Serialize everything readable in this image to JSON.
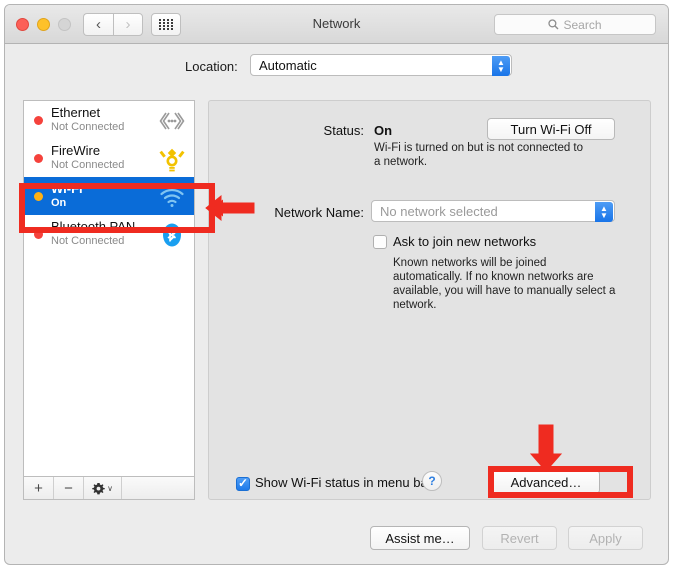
{
  "window": {
    "title": "Network",
    "traffic_lights": [
      "close",
      "minimize",
      "zoom"
    ],
    "back_glyph": "‹",
    "forward_glyph": "›",
    "grid_icon": "grid-view-icon"
  },
  "search": {
    "placeholder": "Search",
    "icon": "search-icon"
  },
  "location": {
    "label": "Location:",
    "value": "Automatic",
    "options": [
      "Automatic"
    ]
  },
  "sidebar": {
    "services": [
      {
        "name": "Ethernet",
        "status": "Not Connected",
        "dot": "red",
        "icon": "ethernet-icon",
        "selected": false
      },
      {
        "name": "FireWire",
        "status": "Not Connected",
        "dot": "red",
        "icon": "firewire-icon",
        "selected": false
      },
      {
        "name": "Wi-Fi",
        "status": "On",
        "dot": "amber",
        "icon": "wifi-icon",
        "selected": true
      },
      {
        "name": "Bluetooth PAN",
        "status": "Not Connected",
        "dot": "red",
        "icon": "bluetooth-icon",
        "selected": false
      }
    ],
    "toolbar": {
      "add": "+",
      "remove": "−",
      "action": "gear-icon",
      "action_chevron": "∨"
    }
  },
  "panel": {
    "status_label": "Status:",
    "status_value": "On",
    "status_note": "Wi-Fi is turned on but is not connected to a network.",
    "toggle_button": "Turn Wi-Fi Off",
    "network_name_label": "Network Name:",
    "network_name_value": "No network selected",
    "ask_join_label": "Ask to join new networks",
    "ask_join_checked": false,
    "ask_join_note": "Known networks will be joined automatically. If no known networks are available, you will have to manually select a network.",
    "show_menubar_label": "Show Wi-Fi status in menu bar",
    "show_menubar_checked": true,
    "advanced_button": "Advanced…",
    "help_button": "?"
  },
  "footer": {
    "assist_button": "Assist me…",
    "revert_button": "Revert",
    "apply_button": "Apply"
  },
  "annotations": {
    "wifi_highlight": "red-highlight-box-wifi-row",
    "wifi_arrow": "red-left-arrow",
    "netname_arrow": "red-left-arrow",
    "advanced_highlight": "red-highlight-box-advanced",
    "advanced_arrow": "red-down-arrow",
    "color": "#ef2b20"
  }
}
